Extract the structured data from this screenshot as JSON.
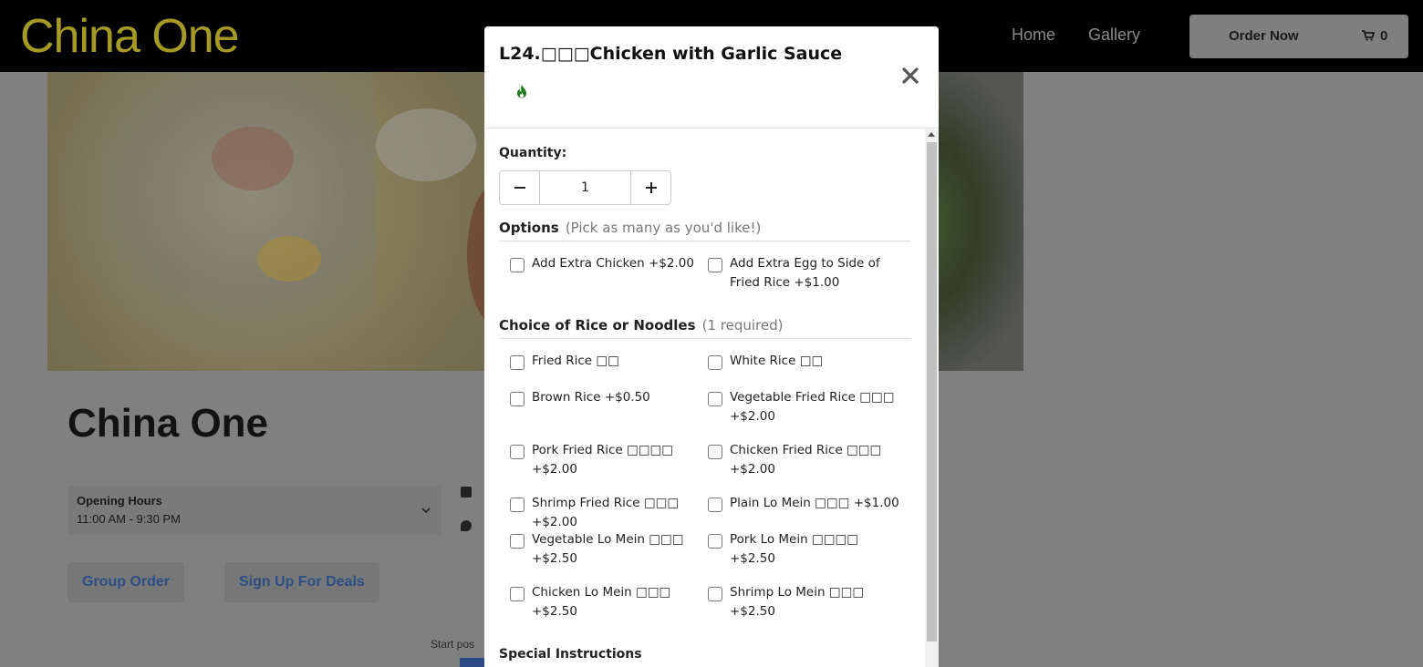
{
  "site": {
    "brand": "China One",
    "nav": {
      "home": "Home",
      "gallery": "Gallery"
    },
    "order_now": "Order Now",
    "cart_count": "0"
  },
  "background": {
    "restaurant_title": "China One",
    "hours_title": "Opening Hours",
    "hours_value": "11:00 AM - 9:30 PM",
    "group_order": "Group Order",
    "sign_up": "Sign Up For Deals",
    "start_text": "Start pos"
  },
  "modal": {
    "title": "L24.□□□Chicken with Garlic Sauce",
    "spicy_color": "#1e7b1e",
    "quantity_label": "Quantity:",
    "quantity_value": "1",
    "options_section": {
      "title": "Options",
      "subtitle": "(Pick as many as you'd like!)",
      "items": [
        "Add Extra Chicken +$2.00",
        "Add Extra Egg to Side of Fried Rice +$1.00"
      ]
    },
    "rice_section": {
      "title": "Choice of Rice or Noodles",
      "subtitle": "(1 required)",
      "items": [
        "Fried Rice □□",
        "White Rice □□",
        "Brown Rice +$0.50",
        "Vegetable Fried Rice □□□ +$2.00",
        "Pork Fried Rice □□□□ +$2.00",
        "Chicken Fried Rice □□□ +$2.00",
        "Shrimp Fried Rice □□□ +$2.00",
        "Plain Lo Mein □□□ +$1.00",
        "Vegetable Lo Mein □□□ +$2.50",
        "Pork Lo Mein □□□□ +$2.50",
        "Chicken Lo Mein □□□ +$2.50",
        "Shrimp Lo Mein □□□ +$2.50"
      ]
    },
    "special_instructions_label": "Special Instructions"
  }
}
